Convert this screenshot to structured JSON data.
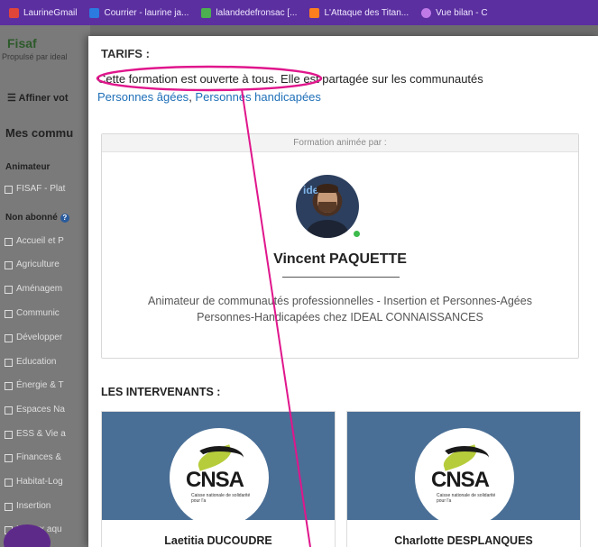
{
  "bookmarks": [
    {
      "label": "LaurineGmail",
      "color": "#e0453a"
    },
    {
      "label": "Courrier - laurine ja...",
      "color": "#2b7be0"
    },
    {
      "label": "lalandedefronsac [...",
      "color": "#4caf50"
    },
    {
      "label": "L'Attaque des Titan...",
      "color": "#ff7f1f"
    },
    {
      "label": "Vue bilan - C",
      "color": "#c07ae8"
    }
  ],
  "sidebar": {
    "logo": "Fisaf",
    "logo_sub": "Propulsé par ideal",
    "refine": "Affiner vot",
    "my_communities": "Mes commu",
    "group_animateur": "Animateur",
    "animateur_items": [
      "FISAF - Plat"
    ],
    "group_non_abonne": "Non abonné",
    "categories": [
      "Accueil et P",
      "Agriculture",
      "Aménagem",
      "Communic",
      "Développer",
      "Education",
      "Énergie & T",
      "Espaces Na",
      "ESS & Vie a",
      "Finances &",
      "Habitat-Log",
      "Insertion",
      "Milieux aqu"
    ]
  },
  "modal": {
    "tarifs_heading": "TARIFS :",
    "desc_open": "Cette formation est ouverte à tous.",
    "desc_shared": " Elle est partagée sur les communautés",
    "community_links": [
      "Personnes âgées",
      "Personnes handicapées"
    ],
    "link_separator": ", ",
    "animated_by": "Formation animée par :",
    "animator_name": "Vincent PAQUETTE",
    "animator_avatar_text": "ide",
    "animator_role_line1": "Animateur de communautés professionnelles - Insertion et Personnes-Agées",
    "animator_role_line2": "Personnes-Handicapées chez IDEAL CONNAISSANCES",
    "intervenants_heading": "LES INTERVENANTS :",
    "intervenants": [
      {
        "name": "Laetitia DUCOUDRE",
        "logo_word": "CNSA",
        "logo_sub": "Caisse nationale de solidarité pour l'a"
      },
      {
        "name": "Charlotte DESPLANQUES",
        "logo_word": "CNSA",
        "logo_sub": "Caisse nationale de solidarité pour l'a"
      }
    ]
  },
  "colors": {
    "annotation": "#e0168c",
    "link": "#1e6fb8",
    "bookmark_bar": "#5b2fa0",
    "banner": "#4a6f96"
  }
}
